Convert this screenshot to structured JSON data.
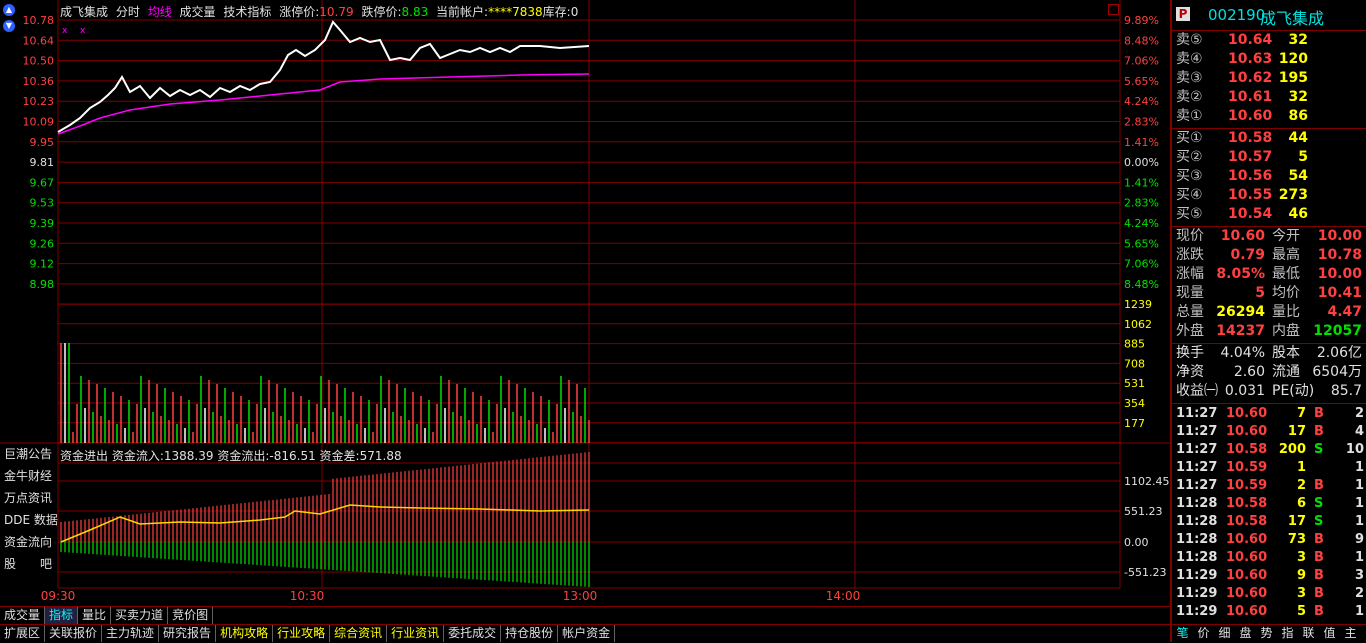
{
  "header": {
    "name": "成飞集成",
    "items": [
      "分时",
      "均线",
      "成交量",
      "技术指标"
    ],
    "limit_up_label": "涨停价:",
    "limit_up": "10.79",
    "limit_down_label": "跌停价:",
    "limit_down": "8.83",
    "account_label": "当前帐户:",
    "account": "****7838",
    "stock_label": "库存:",
    "stock": "0"
  },
  "price_axis_left": [
    "10.78",
    "10.64",
    "10.50",
    "10.36",
    "10.23",
    "10.09",
    "9.95",
    "9.81",
    "9.67",
    "9.53",
    "9.39",
    "9.26",
    "9.12",
    "8.98"
  ],
  "pct_axis_right": [
    "9.89%",
    "8.48%",
    "7.06%",
    "5.65%",
    "4.24%",
    "2.83%",
    "1.41%",
    "0.00%",
    "1.41%",
    "2.83%",
    "4.24%",
    "5.65%",
    "7.06%",
    "8.48%"
  ],
  "volume_axis": [
    "1239",
    "1062",
    "885",
    "708",
    "531",
    "354",
    "177"
  ],
  "fund_header": {
    "title": "资金进出",
    "in_label": "资金流入:",
    "in": "1388.39",
    "out_label": "资金流出:",
    "out": "-816.51",
    "diff_label": "资金差:",
    "diff": "571.88"
  },
  "fund_axis": [
    "1102.45",
    "551.23",
    "0.00",
    "-551.23"
  ],
  "side_buttons": [
    "巨潮公告",
    "金牛财经",
    "万点资讯",
    "DDE 数据",
    "资金流向",
    "股　　吧"
  ],
  "time_axis": [
    "09:30",
    "10:30",
    "13:00",
    "14:00"
  ],
  "tabs_row1": [
    "成交量",
    "指标",
    "量比",
    "买卖力道",
    "竞价图"
  ],
  "tabs_row2": [
    "扩展区",
    "关联报价",
    "主力轨迹",
    "研究报告",
    "机构攻略",
    "行业攻略",
    "综合资讯",
    "行业资讯",
    "委托成交",
    "持仓股份",
    "帐户资金"
  ],
  "panel": {
    "badge": "P",
    "code": "002190",
    "name": "成飞集成",
    "sells": [
      {
        "label": "卖⑤",
        "price": "10.64",
        "vol": "32"
      },
      {
        "label": "卖④",
        "price": "10.63",
        "vol": "120"
      },
      {
        "label": "卖③",
        "price": "10.62",
        "vol": "195"
      },
      {
        "label": "卖②",
        "price": "10.61",
        "vol": "32"
      },
      {
        "label": "卖①",
        "price": "10.60",
        "vol": "86"
      }
    ],
    "buys": [
      {
        "label": "买①",
        "price": "10.58",
        "vol": "44"
      },
      {
        "label": "买②",
        "price": "10.57",
        "vol": "5"
      },
      {
        "label": "买③",
        "price": "10.56",
        "vol": "54"
      },
      {
        "label": "买④",
        "price": "10.55",
        "vol": "273"
      },
      {
        "label": "买⑤",
        "price": "10.54",
        "vol": "46"
      }
    ],
    "stats": [
      {
        "l1": "现价",
        "v1": "10.60",
        "c1": "red",
        "l2": "今开",
        "v2": "10.00",
        "c2": "red"
      },
      {
        "l1": "涨跌",
        "v1": "0.79",
        "c1": "red",
        "l2": "最高",
        "v2": "10.78",
        "c2": "red"
      },
      {
        "l1": "涨幅",
        "v1": "8.05%",
        "c1": "red",
        "l2": "最低",
        "v2": "10.00",
        "c2": "red"
      },
      {
        "l1": "现量",
        "v1": "5",
        "c1": "red",
        "l2": "均价",
        "v2": "10.41",
        "c2": "red"
      },
      {
        "l1": "总量",
        "v1": "26294",
        "c1": "yellow",
        "l2": "量比",
        "v2": "4.47",
        "c2": "red"
      },
      {
        "l1": "外盘",
        "v1": "14237",
        "c1": "red",
        "l2": "内盘",
        "v2": "12057",
        "c2": "green"
      }
    ],
    "stats2": [
      {
        "l1": "换手",
        "v1": "4.04%",
        "l2": "股本",
        "v2": "2.06亿"
      },
      {
        "l1": "净资",
        "v1": "2.60",
        "l2": "流通",
        "v2": "6504万"
      },
      {
        "l1": "收益㈠",
        "v1": "0.031",
        "l2": "PE(动)",
        "v2": "85.7"
      }
    ],
    "ticks": [
      {
        "t": "11:27",
        "p": "10.60",
        "v": "7",
        "s": "B",
        "n": "2"
      },
      {
        "t": "11:27",
        "p": "10.60",
        "v": "17",
        "s": "B",
        "n": "4"
      },
      {
        "t": "11:27",
        "p": "10.58",
        "v": "200",
        "s": "S",
        "n": "10"
      },
      {
        "t": "11:27",
        "p": "10.59",
        "v": "1",
        "s": "",
        "n": "1"
      },
      {
        "t": "11:27",
        "p": "10.59",
        "v": "2",
        "s": "B",
        "n": "1"
      },
      {
        "t": "11:28",
        "p": "10.58",
        "v": "6",
        "s": "S",
        "n": "1"
      },
      {
        "t": "11:28",
        "p": "10.58",
        "v": "17",
        "s": "S",
        "n": "1"
      },
      {
        "t": "11:28",
        "p": "10.60",
        "v": "73",
        "s": "B",
        "n": "9"
      },
      {
        "t": "11:28",
        "p": "10.60",
        "v": "3",
        "s": "B",
        "n": "1"
      },
      {
        "t": "11:29",
        "p": "10.60",
        "v": "9",
        "s": "B",
        "n": "3"
      },
      {
        "t": "11:29",
        "p": "10.60",
        "v": "3",
        "s": "B",
        "n": "2"
      },
      {
        "t": "11:29",
        "p": "10.60",
        "v": "5",
        "s": "B",
        "n": "1"
      }
    ],
    "bottom_tabs": [
      "笔",
      "价",
      "细",
      "盘",
      "势",
      "指",
      "联",
      "值",
      "主"
    ]
  },
  "colors": {
    "up": "#ff4040",
    "down": "#00e000",
    "grid": "#800000",
    "price_line": "#ffffff",
    "avg_line": "#ff00ff",
    "fund_line": "#ffd700"
  }
}
